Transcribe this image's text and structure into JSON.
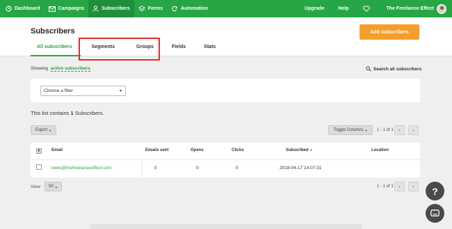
{
  "nav": {
    "items": [
      {
        "label": "Dashboard",
        "icon": "clock-icon"
      },
      {
        "label": "Campaigns",
        "icon": "envelope-icon"
      },
      {
        "label": "Subscribers",
        "icon": "user-icon"
      },
      {
        "label": "Forms",
        "icon": "layers-icon"
      },
      {
        "label": "Automation",
        "icon": "refresh-icon"
      }
    ],
    "upgrade": "Upgrade",
    "help": "Help",
    "account_name": "The Freelance Effect"
  },
  "page": {
    "title": "Subscribers",
    "add_button": "Add subscribers",
    "tabs": [
      "All subscribers",
      "Segments",
      "Groups",
      "Fields",
      "Stats"
    ]
  },
  "showing": {
    "prefix": "Showing",
    "link": "active subscribers",
    "search_all": "Search all subscribers"
  },
  "filter": {
    "selected": "Choose a filter"
  },
  "summary": {
    "prefix": "This list contains",
    "count": "1",
    "suffix": "Subscribers."
  },
  "toolbar": {
    "export": "Export",
    "toggle_columns": "Toggle Columns",
    "pager_text": "1 - 1 of 1",
    "prev": "‹",
    "next": "›"
  },
  "table": {
    "columns": [
      "Email",
      "Emails sent",
      "Opens",
      "Clicks",
      "Subscribed",
      "Location"
    ],
    "rows": [
      {
        "email": "lewis@thefreelanceeffect.com",
        "emails_sent": "0",
        "opens": "0",
        "clicks": "0",
        "subscribed": "2018-04-17 14:07:31",
        "location": ""
      }
    ]
  },
  "footer": {
    "view_label": "View",
    "per_page": "50",
    "pager_text": "1 - 1 of 1",
    "prev": "‹",
    "next": "›"
  },
  "widgets": {
    "help_glyph": "?"
  },
  "colors": {
    "brand": "#26a644",
    "accent": "#f59e2a",
    "highlight": "#e52b2b"
  }
}
